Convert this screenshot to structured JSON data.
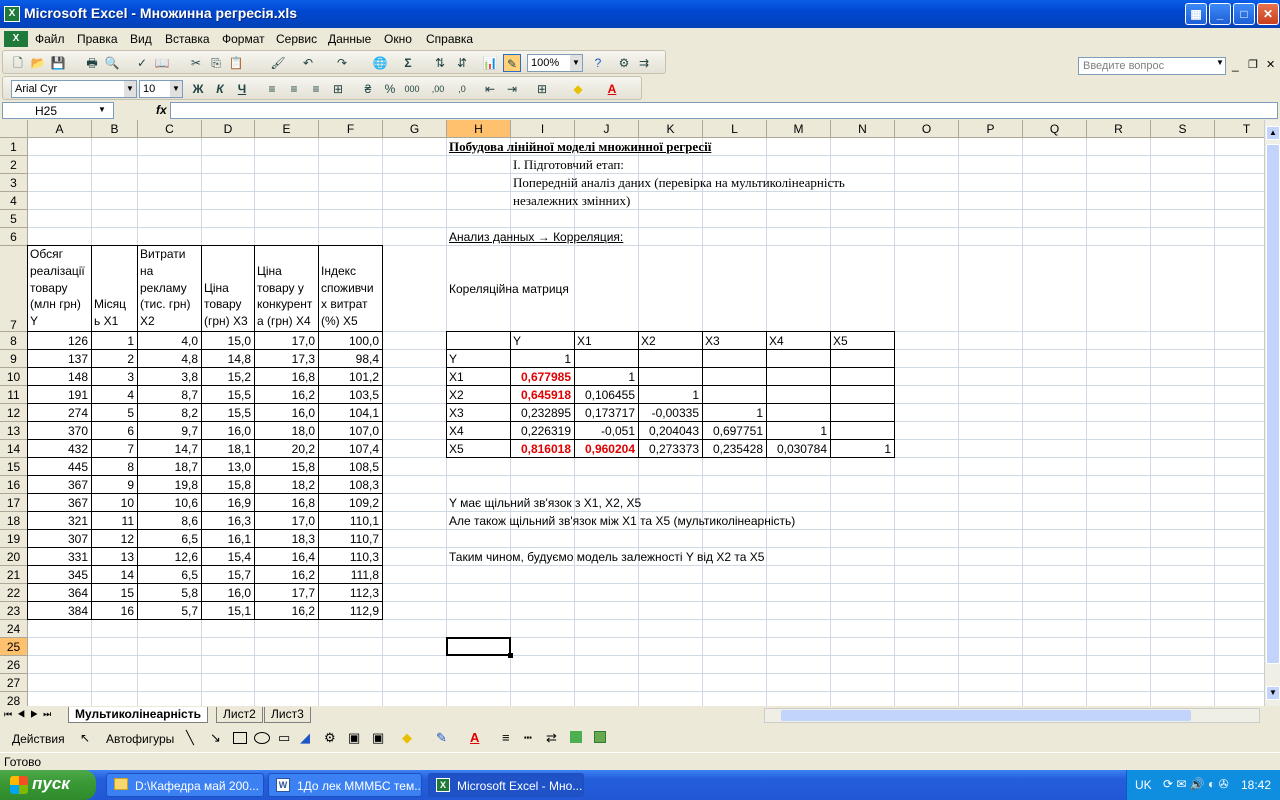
{
  "window": {
    "title": "Microsoft Excel - Множинна регресія.xls",
    "minimize": "_",
    "maximize": "□",
    "close": "✕"
  },
  "menu": {
    "items": [
      "Файл",
      "Правка",
      "Вид",
      "Вставка",
      "Формат",
      "Сервис",
      "Данные",
      "Окно",
      "Справка"
    ],
    "help_placeholder": "Введите вопрос"
  },
  "toolbar": {
    "zoom": "100%",
    "font_name": "Arial Cyr",
    "font_size": "10",
    "bold": "Ж",
    "italic": "К",
    "underline": "Ч",
    "percent": "%",
    "thousands": "000",
    "inc_decimal": ",00",
    "dec_decimal": ",0"
  },
  "formula_bar": {
    "name_box": "H25",
    "fx": "fx",
    "content": ""
  },
  "sheet": {
    "columns": [
      "A",
      "B",
      "C",
      "D",
      "E",
      "F",
      "G",
      "H",
      "I",
      "J",
      "K",
      "L",
      "M",
      "N",
      "O",
      "P",
      "Q",
      "R",
      "S",
      "T"
    ],
    "rows": [
      "1",
      "2",
      "3",
      "4",
      "5",
      "6",
      "7",
      "8",
      "9",
      "10",
      "11",
      "12",
      "13",
      "14",
      "15",
      "16",
      "17",
      "18",
      "19",
      "20",
      "21",
      "22",
      "23",
      "24",
      "25",
      "26",
      "27",
      "28"
    ],
    "selected_cell": "H25",
    "headers": {
      "a7": [
        "Обсяг",
        "реалізації",
        "товару",
        "(млн грн)",
        "Y"
      ],
      "b7": [
        "Місяц",
        "ь  X1"
      ],
      "c7": [
        "Витрати",
        "на",
        "рекламу",
        "(тис. грн)",
        "X2"
      ],
      "d7": [
        "Ціна",
        "товару",
        "(грн) X3"
      ],
      "e7": [
        "Ціна",
        "товару у",
        "конкурент",
        "а (грн) X4"
      ],
      "f7": [
        "Індекс",
        "споживчи",
        "х витрат",
        "(%) X5"
      ]
    },
    "data_rows": [
      [
        "126",
        "1",
        "4,0",
        "15,0",
        "17,0",
        "100,0"
      ],
      [
        "137",
        "2",
        "4,8",
        "14,8",
        "17,3",
        "98,4"
      ],
      [
        "148",
        "3",
        "3,8",
        "15,2",
        "16,8",
        "101,2"
      ],
      [
        "191",
        "4",
        "8,7",
        "15,5",
        "16,2",
        "103,5"
      ],
      [
        "274",
        "5",
        "8,2",
        "15,5",
        "16,0",
        "104,1"
      ],
      [
        "370",
        "6",
        "9,7",
        "16,0",
        "18,0",
        "107,0"
      ],
      [
        "432",
        "7",
        "14,7",
        "18,1",
        "20,2",
        "107,4"
      ],
      [
        "445",
        "8",
        "18,7",
        "13,0",
        "15,8",
        "108,5"
      ],
      [
        "367",
        "9",
        "19,8",
        "15,8",
        "18,2",
        "108,3"
      ],
      [
        "367",
        "10",
        "10,6",
        "16,9",
        "16,8",
        "109,2"
      ],
      [
        "321",
        "11",
        "8,6",
        "16,3",
        "17,0",
        "110,1"
      ],
      [
        "307",
        "12",
        "6,5",
        "16,1",
        "18,3",
        "110,7"
      ],
      [
        "331",
        "13",
        "12,6",
        "15,4",
        "16,4",
        "110,3"
      ],
      [
        "345",
        "14",
        "6,5",
        "15,7",
        "16,2",
        "111,8"
      ],
      [
        "364",
        "15",
        "5,8",
        "16,0",
        "17,7",
        "112,3"
      ],
      [
        "384",
        "16",
        "5,7",
        "15,1",
        "16,2",
        "112,9"
      ]
    ],
    "text": {
      "h1": "Побудова лінійної моделі множинної регресії",
      "i2": "І. Підготовчий етап:",
      "i3": "Попередній аналіз даних (перевірка на мультиколінеарність",
      "i4": "незалежних змінних)",
      "h6": "Анализ данных → Корреляция:",
      "h7": "Кореляційна матриця",
      "h17": "Y має щільний зв'язок з X1, X2,  X5",
      "h18": "Але також щільний зв'язок між X1 та X5 (мультиколінеарність)",
      "h20": "Таким чином, будуємо модель залежності  Y від X2 та X5"
    },
    "corr": {
      "col_labels": [
        "Y",
        "X1",
        "X2",
        "X3",
        "X4",
        "X5"
      ],
      "row_labels": [
        "Y",
        "X1",
        "X2",
        "X3",
        "X4",
        "X5"
      ],
      "values": [
        [
          "1",
          "",
          "",
          "",
          "",
          ""
        ],
        [
          "0,677985",
          "1",
          "",
          "",
          "",
          ""
        ],
        [
          "0,645918",
          "0,106455",
          "1",
          "",
          "",
          ""
        ],
        [
          "0,232895",
          "0,173717",
          "-0,00335",
          "1",
          "",
          ""
        ],
        [
          "0,226319",
          "-0,051",
          "0,204043",
          "0,697751",
          "1",
          ""
        ],
        [
          "0,816018",
          "0,960204",
          "0,273373",
          "0,235428",
          "0,030784",
          "1"
        ]
      ],
      "highlight_color": "#e00000"
    }
  },
  "tabs": {
    "items": [
      "Мультиколінеарність",
      "Лист2",
      "Лист3"
    ],
    "active": "Мультиколінеарність"
  },
  "drawing": {
    "actions": "Действия",
    "autoshapes": "Автофигуры"
  },
  "status": {
    "text": "Готово"
  },
  "taskbar": {
    "start": "пуск",
    "items": [
      "D:\\Кафедра май 200...",
      "1До лек МММБС тем...",
      "Microsoft Excel - Мно..."
    ],
    "lang": "UK",
    "time": "18:42"
  }
}
